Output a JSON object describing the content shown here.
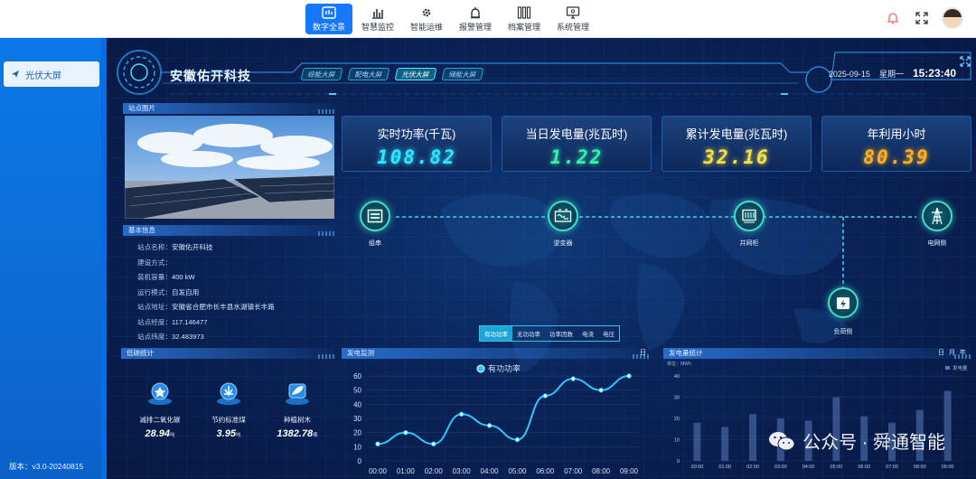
{
  "nav": {
    "items": [
      {
        "label": "数字全景",
        "icon": "dashboard-icon",
        "active": true
      },
      {
        "label": "智慧监控",
        "icon": "bar-chart-icon",
        "active": false
      },
      {
        "label": "智能运维",
        "icon": "gear-icon",
        "active": false
      },
      {
        "label": "报警管理",
        "icon": "alarm-icon",
        "active": false
      },
      {
        "label": "档案管理",
        "icon": "archive-icon",
        "active": false
      },
      {
        "label": "系统管理",
        "icon": "monitor-icon",
        "active": false
      }
    ]
  },
  "sidebar": {
    "items": [
      {
        "label": "光伏大屏",
        "icon": "send-icon"
      }
    ],
    "version": "版本：v3.0-20240815"
  },
  "header": {
    "brand": "安徽佑开科技",
    "tabs": [
      {
        "label": "综能大屏",
        "active": false
      },
      {
        "label": "配电大屏",
        "active": false
      },
      {
        "label": "光伏大屏",
        "active": true
      },
      {
        "label": "储能大屏",
        "active": false
      }
    ],
    "date": "2025-09-15",
    "weekday": "星期一",
    "time": "15:23:40"
  },
  "station_photo": {
    "title": "站点图片"
  },
  "basic_info": {
    "title": "基本信息",
    "rows": [
      {
        "label": "站点名称：",
        "value": "安徽佑开科技"
      },
      {
        "label": "建设方式：",
        "value": ""
      },
      {
        "label": "装机容量：",
        "value": "400 kW"
      },
      {
        "label": "运行模式：",
        "value": "自发自用"
      },
      {
        "label": "站点地址：",
        "value": "安徽省合肥市长丰县水湖镇长丰路"
      },
      {
        "label": "站点经度：",
        "value": "117.146477"
      },
      {
        "label": "站点纬度：",
        "value": "32.483973"
      }
    ]
  },
  "kpis": [
    {
      "label": "实时功率(千瓦)",
      "value": "108.82",
      "color": "#2ee6ff"
    },
    {
      "label": "当日发电量(兆瓦时)",
      "value": "1.22",
      "color": "#35f0a8"
    },
    {
      "label": "累计发电量(兆瓦时)",
      "value": "32.16",
      "color": "#f3e14a"
    },
    {
      "label": "年利用小时",
      "value": "80.39",
      "color": "#ffb020"
    }
  ],
  "flow": {
    "nodes": [
      {
        "label": "组串",
        "icon": "pv-panel-icon"
      },
      {
        "label": "逆变器",
        "icon": "inverter-icon"
      },
      {
        "label": "并网柜",
        "icon": "cabinet-icon"
      },
      {
        "label": "电网侧",
        "icon": "power-tower-icon"
      },
      {
        "label": "负荷侧",
        "icon": "load-battery-icon"
      }
    ]
  },
  "metric_tabs": [
    {
      "label": "有功功率",
      "active": true
    },
    {
      "label": "无功功率",
      "active": false
    },
    {
      "label": "功率因数",
      "active": false
    },
    {
      "label": "电流",
      "active": false
    },
    {
      "label": "电压",
      "active": false
    }
  ],
  "carbon": {
    "title": "低碳统计",
    "items": [
      {
        "label": "减排二氧化碳",
        "value": "28.94",
        "unit": "吨",
        "icon": "co2-icon"
      },
      {
        "label": "节约标准煤",
        "value": "3.95",
        "unit": "吨",
        "icon": "coal-icon"
      },
      {
        "label": "种植树木",
        "value": "1382.78",
        "unit": "棵",
        "icon": "tree-icon"
      }
    ]
  },
  "gen_monitor": {
    "title": "发电监测",
    "tab": "日"
  },
  "gen_stats": {
    "title": "发电量统计",
    "tabs": [
      "日",
      "月",
      "年"
    ],
    "unit_label": "单位：MWh",
    "legend": "发电量"
  },
  "watermark": {
    "text": "公众号 · 舜通智能"
  },
  "chart_data": [
    {
      "type": "line",
      "title": "",
      "series": [
        {
          "name": "有功功率",
          "values": [
            12,
            20,
            12,
            33,
            25,
            15,
            46,
            58,
            50,
            60
          ]
        }
      ],
      "categories": [
        "00:00",
        "01:00",
        "02:00",
        "03:00",
        "04:00",
        "05:00",
        "06:00",
        "07:00",
        "08:00",
        "09:00"
      ],
      "ylim": [
        0,
        60
      ],
      "yticks": [
        0,
        10,
        20,
        30,
        40,
        50,
        60
      ],
      "legend": "top",
      "color": "#2ec8ff"
    },
    {
      "type": "bar",
      "title": "",
      "categories": [
        "00:00",
        "01:00",
        "02:00",
        "03:00",
        "04:00",
        "05:00",
        "06:00",
        "07:00",
        "08:00",
        "09:00"
      ],
      "series": [
        {
          "name": "发电量",
          "values": [
            18,
            16,
            22,
            20,
            19,
            30,
            21,
            18,
            24,
            33
          ]
        }
      ],
      "ylim": [
        0,
        40
      ],
      "yticks": [
        0,
        10,
        20,
        30,
        40
      ],
      "legend": "top-right",
      "color": "#5a7ab8"
    }
  ]
}
